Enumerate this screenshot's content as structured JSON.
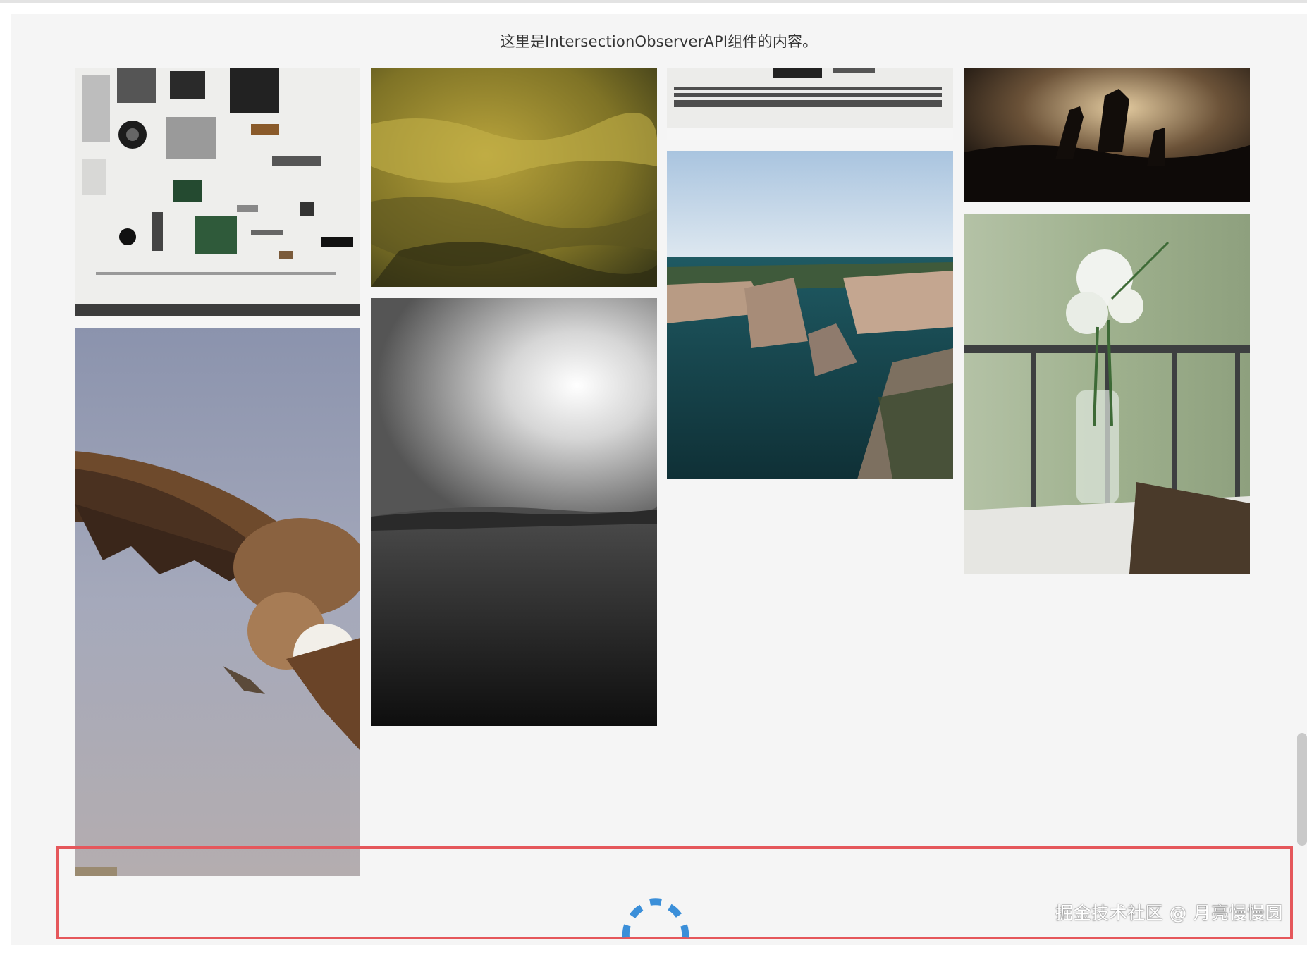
{
  "header": {
    "text": "这里是IntersectionObserverAPI组件的内容。"
  },
  "gallery": {
    "images": [
      {
        "subject": "electronic components flat lay"
      },
      {
        "subject": "vulture in flight"
      },
      {
        "subject": "moss close-up"
      },
      {
        "subject": "black and white landscape with sun"
      },
      {
        "subject": "hardware parts on white"
      },
      {
        "subject": "coastal cliffs and sea"
      },
      {
        "subject": "concert crowd silhouettes"
      },
      {
        "subject": "flowers in glass vase on balcony table"
      }
    ]
  },
  "loader": {
    "state": "loading",
    "accent": "#3b8fd9"
  },
  "highlight": {
    "color": "#e5575b"
  },
  "watermark": {
    "text": "掘金技术社区 @ 月亮慢慢圆"
  }
}
